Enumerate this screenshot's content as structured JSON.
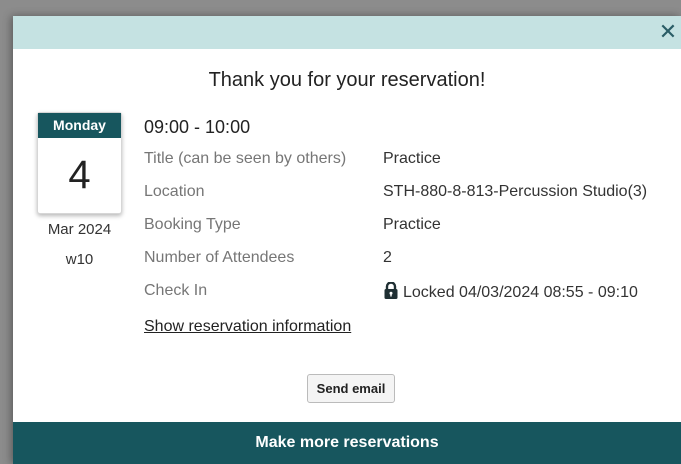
{
  "dialog": {
    "title": "Thank you for your reservation!",
    "close_icon": "close-icon"
  },
  "date": {
    "day_name": "Monday",
    "day_number": "4",
    "month_year": "Mar 2024",
    "week": "w10"
  },
  "reservation": {
    "time_range": "09:00 - 10:00",
    "details": [
      {
        "label": "Title (can be seen by others)",
        "value": "Practice"
      },
      {
        "label": "Location",
        "value": "STH-880-8-813-Percussion Studio(3)"
      },
      {
        "label": "Booking Type",
        "value": "Practice"
      },
      {
        "label": "Number of Attendees",
        "value": "2"
      },
      {
        "label": "Check In",
        "value": "Locked 04/03/2024 08:55 - 09:10",
        "icon": "lock-icon"
      }
    ],
    "show_info_label": "Show reservation information"
  },
  "actions": {
    "send_email_label": "Send email",
    "make_more_label": "Make more reservations"
  },
  "colors": {
    "header_bg": "#c5e2e2",
    "primary": "#17565e"
  }
}
